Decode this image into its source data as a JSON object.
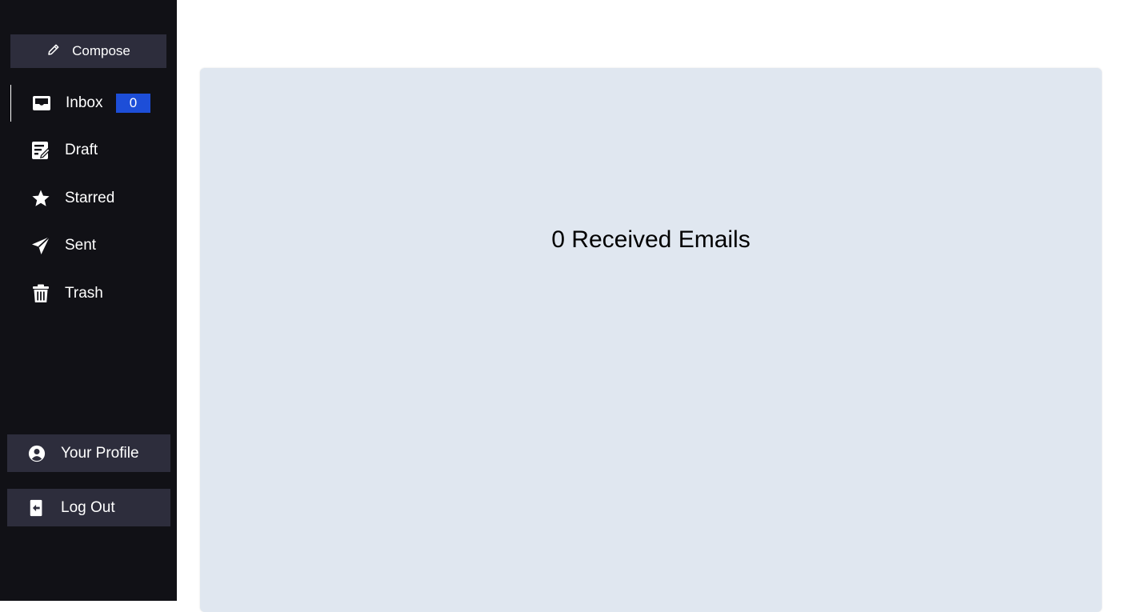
{
  "sidebar": {
    "compose": {
      "label": "Compose",
      "icon": "pencil-icon"
    },
    "items": [
      {
        "label": "Inbox",
        "icon": "inbox-icon",
        "badge": "0",
        "active": true
      },
      {
        "label": "Draft",
        "icon": "draft-icon"
      },
      {
        "label": "Starred",
        "icon": "star-icon"
      },
      {
        "label": "Sent",
        "icon": "send-icon"
      },
      {
        "label": "Trash",
        "icon": "trash-icon"
      }
    ],
    "profile": {
      "label": "Your Profile",
      "icon": "user-circle-icon"
    },
    "logout": {
      "label": "Log Out",
      "icon": "logout-icon"
    }
  },
  "main": {
    "message": "0 Received Emails"
  },
  "colors": {
    "sidebar_bg": "#111116",
    "button_bg": "#2d2d3c",
    "badge_bg": "#1d4ed8",
    "panel_bg": "#e0e7f0"
  }
}
